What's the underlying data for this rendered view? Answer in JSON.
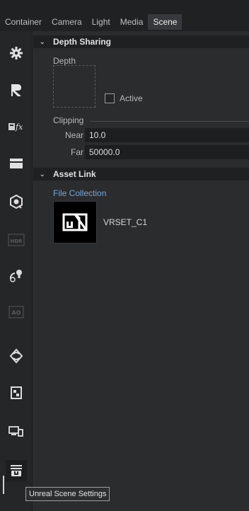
{
  "tabs": [
    {
      "label": "Container"
    },
    {
      "label": "Camera"
    },
    {
      "label": "Light"
    },
    {
      "label": "Media"
    },
    {
      "label": "Scene",
      "active": true
    }
  ],
  "sidebar": {
    "icons": [
      "gear-icon",
      "r-logo-icon",
      "fx-icon",
      "clapper-icon",
      "cube-target-icon",
      "hdr-icon",
      "light-bulb-icon",
      "ao-icon",
      "swirl-icon",
      "image-file-icon",
      "devices-icon",
      "unreal-scene-settings-icon"
    ],
    "hdr_text": "HDR",
    "ao_text": "AO",
    "fx_text": "fx"
  },
  "depth_sharing": {
    "title": "Depth Sharing",
    "depth_label": "Depth",
    "active_label": "Active",
    "active_checked": false,
    "clipping_label": "Clipping",
    "near_label": "Near",
    "near_value": "10.0",
    "far_label": "Far",
    "far_value": "50000.0"
  },
  "asset_link": {
    "title": "Asset Link",
    "collection_label": "File Collection",
    "asset_name": "VRSET_C1"
  },
  "tooltip": "Unreal Scene Settings",
  "colors": {
    "link": "#6fa8dc",
    "panel_bg": "#2b2c2e",
    "header_bg": "#1f2022"
  }
}
